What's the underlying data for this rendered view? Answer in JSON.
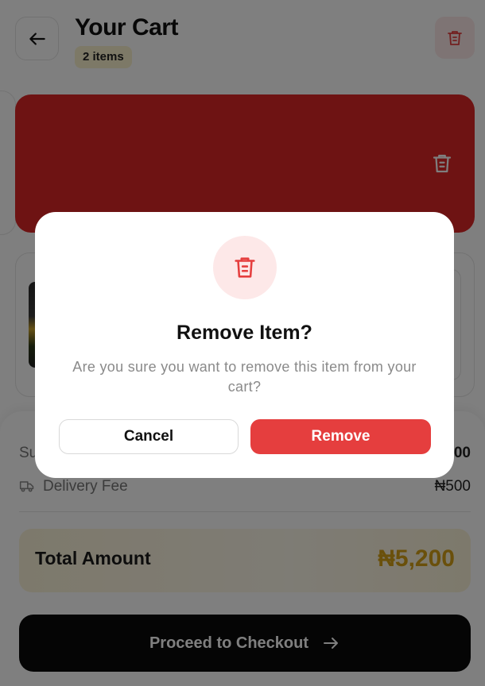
{
  "header": {
    "title": "Your Cart",
    "item_count": "2 items"
  },
  "summary": {
    "subtotal_label": "Subtotal",
    "subtotal_value": "₦4,700",
    "delivery_label": "Delivery Fee",
    "delivery_value": "₦500",
    "total_label": "Total Amount",
    "total_value": "₦5,200"
  },
  "checkout": {
    "label": "Proceed to Checkout"
  },
  "dialog": {
    "title": "Remove Item?",
    "message": "Are you sure you want to remove this item from your cart?",
    "cancel_label": "Cancel",
    "remove_label": "Remove"
  },
  "colors": {
    "danger": "#e53e3e",
    "danger_soft": "#fde8e8",
    "accent_gold": "#d4a017",
    "badge_bg": "#fbf2cf",
    "checkout_bg": "#0a0a0a"
  },
  "icons": [
    "back-arrow-icon",
    "trash-icon",
    "truck-icon",
    "arrow-right-icon"
  ]
}
